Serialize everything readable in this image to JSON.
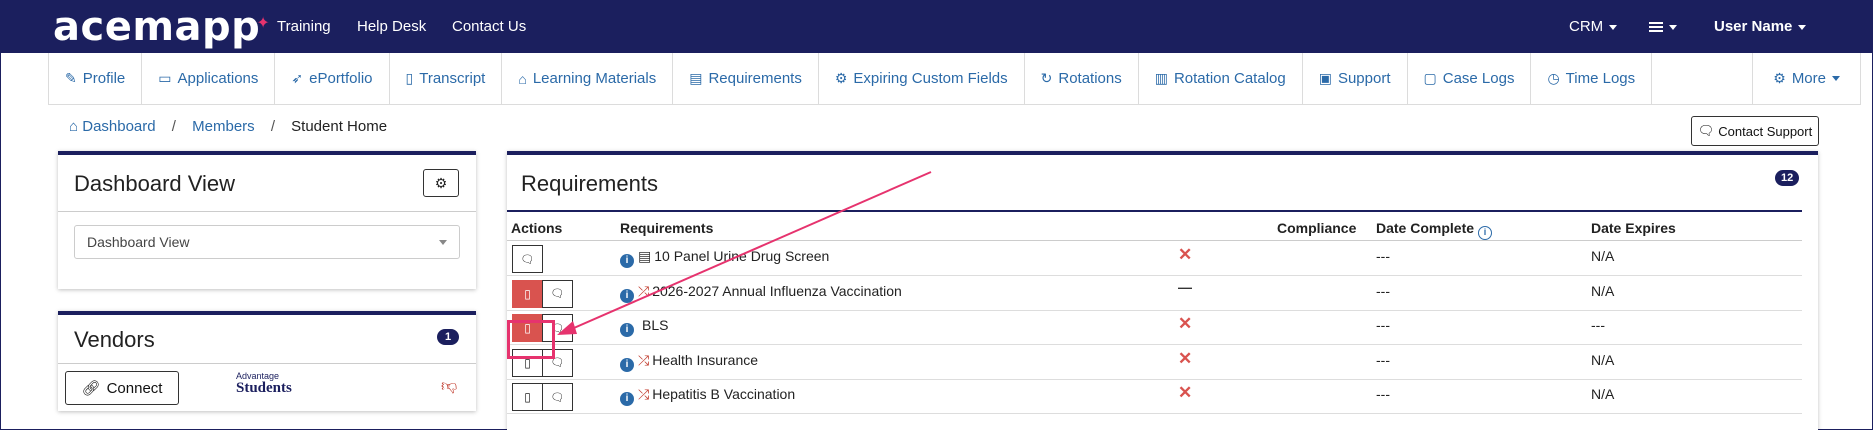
{
  "topbar": {
    "logo": "acemapp",
    "links": [
      "Training",
      "Help Desk",
      "Contact Us"
    ],
    "crm": "CRM",
    "user": "User Name"
  },
  "tabs": [
    {
      "label": "Profile",
      "icon": "pencil-icon",
      "glyph": "✎"
    },
    {
      "label": "Applications",
      "icon": "id-card-icon",
      "glyph": "▭"
    },
    {
      "label": "ePortfolio",
      "icon": "rocket-icon",
      "glyph": "➶"
    },
    {
      "label": "Transcript",
      "icon": "file-icon",
      "glyph": "▯"
    },
    {
      "label": "Learning Materials",
      "icon": "graduation-cap-icon",
      "glyph": "⌂"
    },
    {
      "label": "Requirements",
      "icon": "list-icon",
      "glyph": "▤"
    },
    {
      "label": "Expiring Custom Fields",
      "icon": "gears-icon",
      "glyph": "⚙"
    },
    {
      "label": "Rotations",
      "icon": "rotate-icon",
      "glyph": "↻"
    },
    {
      "label": "Rotation Catalog",
      "icon": "book-icon",
      "glyph": "▥"
    },
    {
      "label": "Support",
      "icon": "truck-icon",
      "glyph": "▣"
    },
    {
      "label": "Case Logs",
      "icon": "briefcase-icon",
      "glyph": "▢"
    },
    {
      "label": "Time Logs",
      "icon": "clock-icon",
      "glyph": "◷"
    }
  ],
  "more": "More",
  "breadcrumb": {
    "home": "Dashboard",
    "members": "Members",
    "current": "Student Home"
  },
  "contact_support": "Contact Support",
  "dashboard": {
    "title": "Dashboard View",
    "select_value": "Dashboard View"
  },
  "vendors": {
    "title": "Vendors",
    "count": "1",
    "connect": "Connect",
    "logo_small": "Advantage",
    "logo_big": "Students"
  },
  "requirements": {
    "title": "Requirements",
    "count": "12",
    "columns": {
      "actions": "Actions",
      "requirements": "Requirements",
      "compliance": "Compliance",
      "date_complete": "Date Complete",
      "date_expires": "Date Expires"
    },
    "rows": [
      {
        "name": "10 Panel Urine Drug Screen",
        "type_icon": "doc",
        "compliance": "✕",
        "compliance_kind": "x",
        "date_complete": "---",
        "date_expires": "N/A",
        "doc_btn": false,
        "doc_red": false
      },
      {
        "name": "2026-2027 Annual Influenza Vaccination",
        "type_icon": "random",
        "compliance": "—",
        "compliance_kind": "dash",
        "date_complete": "---",
        "date_expires": "N/A",
        "doc_btn": true,
        "doc_red": true
      },
      {
        "name": "BLS",
        "type_icon": "none",
        "compliance": "✕",
        "compliance_kind": "x",
        "date_complete": "---",
        "date_expires": "---",
        "doc_btn": true,
        "doc_red": true
      },
      {
        "name": "Health Insurance",
        "type_icon": "random",
        "compliance": "✕",
        "compliance_kind": "x",
        "date_complete": "---",
        "date_expires": "N/A",
        "doc_btn": true,
        "doc_red": false
      },
      {
        "name": "Hepatitis B Vaccination",
        "type_icon": "random",
        "compliance": "✕",
        "compliance_kind": "x",
        "date_complete": "---",
        "date_expires": "N/A",
        "doc_btn": true,
        "doc_red": false
      }
    ]
  },
  "colors": {
    "navy": "#1b1f5e",
    "link": "#2b6aa8",
    "red": "#d9534f",
    "annotation": "#e6336e"
  }
}
